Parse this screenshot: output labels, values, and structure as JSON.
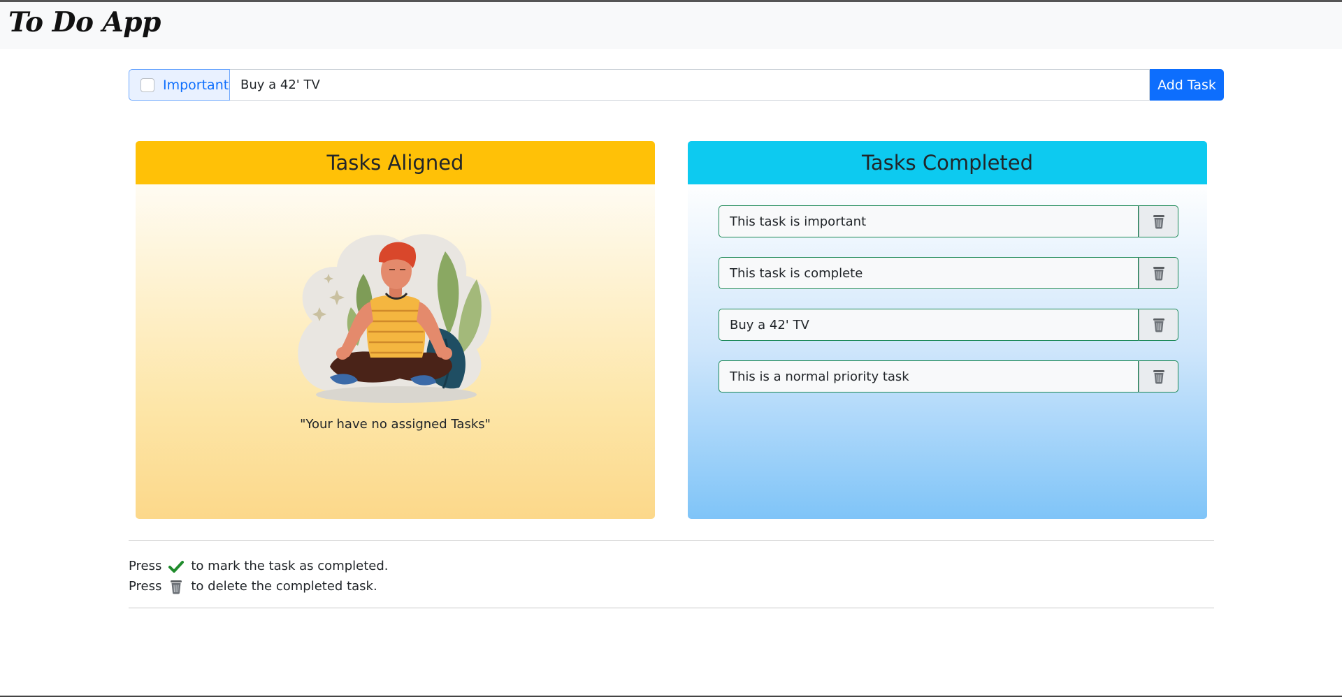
{
  "app": {
    "title": "To Do App"
  },
  "input": {
    "important_label": "Important",
    "value": "Buy a 42' TV",
    "add_button_label": "Add Task"
  },
  "aligned": {
    "title": "Tasks Aligned",
    "empty_message": "\"Your have no assigned Tasks\""
  },
  "completed": {
    "title": "Tasks Completed",
    "tasks": [
      {
        "text": "This task is important"
      },
      {
        "text": "This task is complete"
      },
      {
        "text": "Buy a 42' TV"
      },
      {
        "text": "This is a normal priority task"
      }
    ]
  },
  "instructions": {
    "line1_prefix": "Press",
    "line1_suffix": "to mark the task as completed.",
    "line2_prefix": "Press",
    "line2_suffix": "to delete the completed task."
  },
  "colors": {
    "aligned_header": "#ffc107",
    "completed_header": "#0dcaf0",
    "primary_button": "#0d6efd",
    "task_border": "#198754"
  },
  "icons": {
    "trash": "trash-icon",
    "check": "check-icon"
  }
}
